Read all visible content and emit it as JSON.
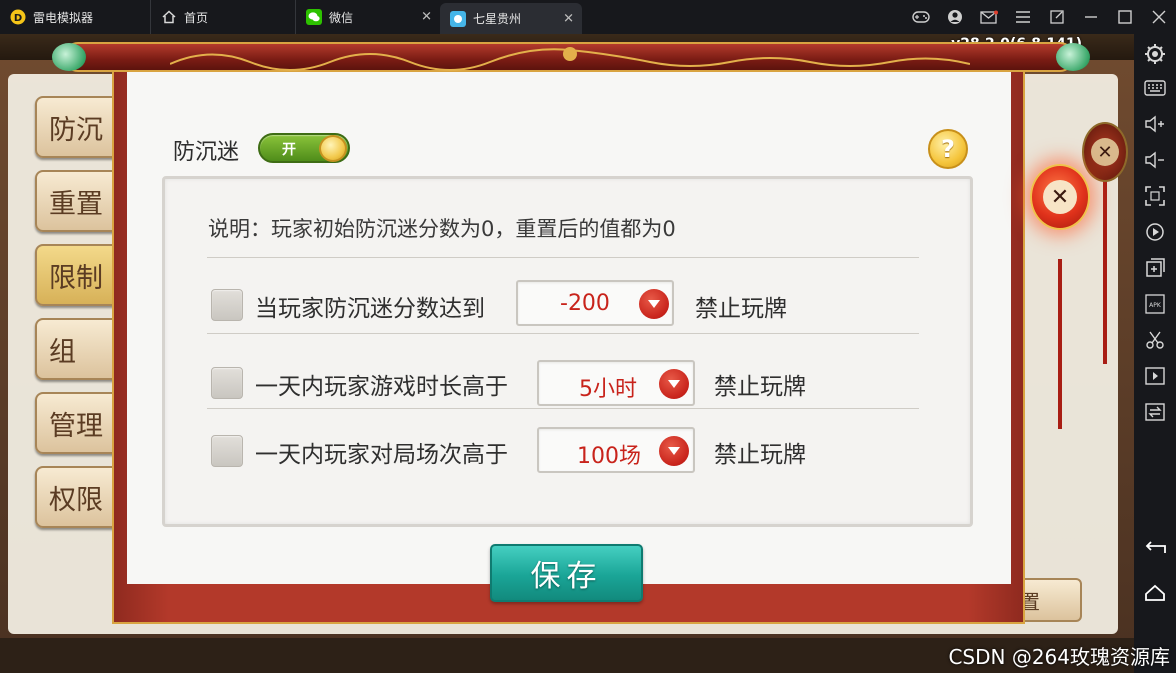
{
  "window": {
    "app_name": "雷电模拟器",
    "tabs": [
      {
        "label": "首页"
      },
      {
        "label": "微信"
      },
      {
        "label": "七星贵州"
      }
    ]
  },
  "game": {
    "version": "v28.2.0(6.8.141)",
    "background_tabs": [
      "防沉",
      "重置",
      "限制",
      "组",
      "管理",
      "权限"
    ],
    "background_right_button": "置"
  },
  "dialog": {
    "title": "防沉迷",
    "toggle_text": "开",
    "help_symbol": "?",
    "description": "说明：玩家初始防沉迷分数为0，重置后的值都为0",
    "rules": [
      {
        "label": "当玩家防沉迷分数达到",
        "value": "-200",
        "suffix": "禁止玩牌",
        "checked": false
      },
      {
        "label": "一天内玩家游戏时长高于",
        "value": "5小时",
        "suffix": "禁止玩牌",
        "checked": false
      },
      {
        "label": "一天内玩家对局场次高于",
        "value": "100场",
        "suffix": "禁止玩牌",
        "checked": false
      }
    ],
    "save_label": "保存",
    "close_symbol": "✕"
  },
  "watermark": "CSDN @264玫瑰资源库",
  "colors": {
    "accent_red": "#c8231b",
    "save_teal": "#1aa597",
    "toggle_green": "#5a9c20"
  }
}
